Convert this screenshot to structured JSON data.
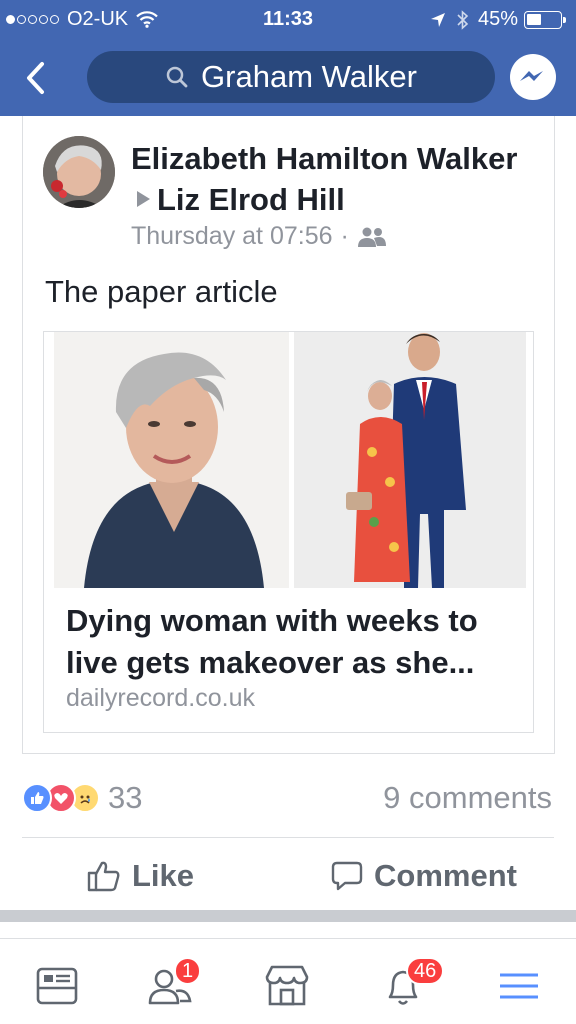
{
  "status_bar": {
    "carrier": "O2-UK",
    "time": "11:33",
    "battery": "45%",
    "battery_level": 0.45
  },
  "header": {
    "search_text": "Graham Walker"
  },
  "post": {
    "author": "Elizabeth Hamilton Walker",
    "recipient": "Liz Elrod Hill",
    "timestamp": "Thursday at 07:56",
    "separator": "·",
    "audience_icon": "friends-icon",
    "text": "The paper article",
    "link": {
      "headline": "Dying woman with weeks to live gets makeover as she...",
      "domain": "dailyrecord.co.uk"
    },
    "reactions_count": "33",
    "comments_count": "9 comments"
  },
  "actions": {
    "like": "Like",
    "comment": "Comment"
  },
  "tabs": {
    "friend_requests_badge": "1",
    "notifications_badge": "46"
  },
  "colors": {
    "brand_blue": "#4267b2",
    "search_bg": "#29487d",
    "badge_red": "#fa3e3e",
    "tab_blue": "#5890ff"
  }
}
